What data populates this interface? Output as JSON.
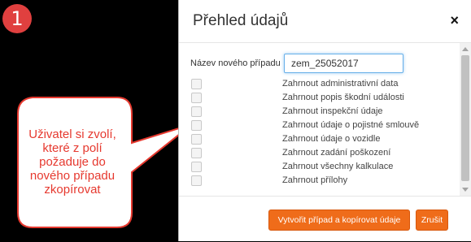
{
  "step_badge": "1",
  "callout": {
    "text": "Uživatel si zvolí, které z polí požaduje do nového případu zkopírovat"
  },
  "modal": {
    "title": "Přehled údajů",
    "close_label": "×",
    "case_name_label": "Název nového případu",
    "case_name_value": "zem_25052017",
    "checkbox_items": [
      "Zahrnout administrativní data",
      "Zahrnout popis škodní události",
      "Zahrnout inspekční údaje",
      "Zahrnout údaje o pojistné smlouvě",
      "Zahrnout údaje o vozidle",
      "Zahrnout zadání poškození",
      "Zahrnout všechny kalkulace",
      "Zahrnout přílohy"
    ],
    "buttons": {
      "create": "Vytvořit případ a kopírovat údaje",
      "cancel": "Zrušit"
    }
  }
}
